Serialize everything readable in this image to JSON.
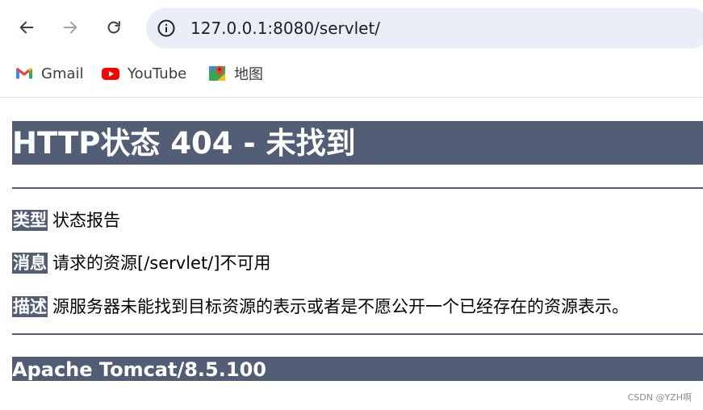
{
  "browser": {
    "url": "127.0.0.1:8080/servlet/",
    "bookmarks": [
      {
        "label": "Gmail",
        "icon": "gmail-icon"
      },
      {
        "label": "YouTube",
        "icon": "youtube-icon"
      },
      {
        "label": "地图",
        "icon": "maps-icon"
      }
    ]
  },
  "page": {
    "title": "HTTP状态 404 - 未找到",
    "fields": [
      {
        "label": "类型",
        "value": "状态报告"
      },
      {
        "label": "消息",
        "value": "请求的资源[/servlet/]不可用"
      },
      {
        "label": "描述",
        "value": "源服务器未能找到目标资源的表示或者是不愿公开一个已经存在的资源表示。"
      }
    ],
    "server": "Apache Tomcat/8.5.100",
    "watermark": "CSDN @YZH啊"
  },
  "colors": {
    "tomcat_bar": "#525d76",
    "address_bar_bg": "#eaeef8",
    "youtube_red": "#ff0000"
  }
}
